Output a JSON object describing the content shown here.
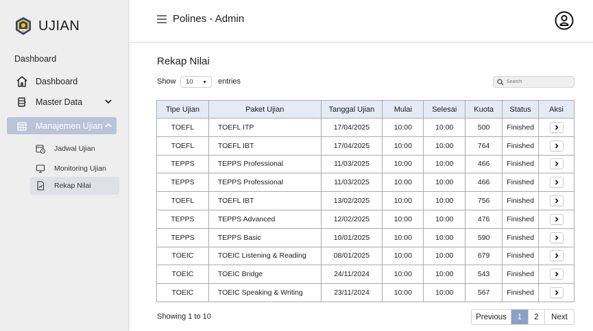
{
  "brand": {
    "name": "UJIAN"
  },
  "sidebar": {
    "section_title": "Dashboard",
    "items": [
      {
        "label": "Dashboard",
        "icon": "home-icon"
      },
      {
        "label": "Master Data",
        "icon": "database-icon"
      },
      {
        "label": "Manajemen Ujian",
        "icon": "calendar-grid-icon"
      }
    ],
    "sub_items": [
      {
        "label": "Jadwal Ujian",
        "icon": "calendar-clock-icon"
      },
      {
        "label": "Monitoring Ujian",
        "icon": "monitor-icon"
      },
      {
        "label": "Rekap Nilai",
        "icon": "document-chart-icon"
      }
    ]
  },
  "header": {
    "title": "Polines - Admin"
  },
  "main": {
    "title": "Rekap Nilai",
    "show_label": "Show",
    "entries_value": "10",
    "entries_label": "entries",
    "search_placeholder": "Search"
  },
  "table": {
    "columns": [
      "Tipe Ujian",
      "Paket Ujian",
      "Tanggal Ujian",
      "Mulai",
      "Selesai",
      "Kuota",
      "Status",
      "Aksi"
    ],
    "rows": [
      [
        "TOEFL",
        "TOEFL ITP",
        "17/04/2025",
        "10:00",
        "10:00",
        "500",
        "Finished"
      ],
      [
        "TOEFL",
        "TOEFL IBT",
        "17/04/2025",
        "10:00",
        "10:00",
        "764",
        "Finished"
      ],
      [
        "TEPPS",
        "TEPPS Professional",
        "11/03/2025",
        "10:00",
        "10:00",
        "466",
        "Finished"
      ],
      [
        "TEPPS",
        "TEPPS Professional",
        "11/03/2025",
        "10:00",
        "10:00",
        "466",
        "Finished"
      ],
      [
        "TOEFL",
        "TOEFL IBT",
        "13/02/2025",
        "10:00",
        "10:00",
        "756",
        "Finished"
      ],
      [
        "TEPPS",
        "TEPPS Advanced",
        "12/02/2025",
        "10:00",
        "10:00",
        "476",
        "Finished"
      ],
      [
        "TEPPS",
        "TEPPS Basic",
        "10/01/2025",
        "10:00",
        "10:00",
        "590",
        "Finished"
      ],
      [
        "TOEIC",
        "TOEIC Listening & Reading",
        "08/01/2025",
        "10:00",
        "10:00",
        "679",
        "Finished"
      ],
      [
        "TOEIC",
        "TOEIC Bridge",
        "24/11/2024",
        "10:00",
        "10:00",
        "543",
        "Finished"
      ],
      [
        "TOEIC",
        "TOEIC  Speaking & Writing",
        "23/11/2024",
        "10:00",
        "10:00",
        "567",
        "Finished"
      ]
    ]
  },
  "footer": {
    "showing": "Showing 1 to 10",
    "prev": "Previous",
    "pages": [
      "1",
      "2"
    ],
    "next": "Next"
  }
}
